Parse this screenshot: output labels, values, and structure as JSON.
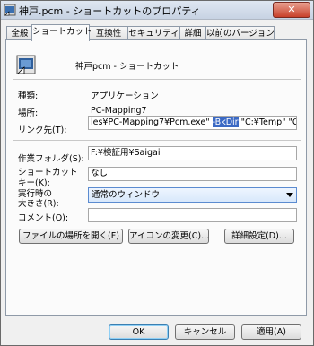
{
  "window": {
    "title": "神戸.pcm - ショートカットのプロパティ",
    "close_glyph": "✕"
  },
  "tabs": [
    {
      "label": "全般"
    },
    {
      "label": "ショートカット"
    },
    {
      "label": "互換性"
    },
    {
      "label": "セキュリティ"
    },
    {
      "label": "詳細"
    },
    {
      "label": "以前のバージョン"
    }
  ],
  "header": {
    "name": "神戸pcm - ショートカット"
  },
  "fields": {
    "type_label": "種類:",
    "type_value": "アプリケーション",
    "location_label": "場所:",
    "location_value": "PC-Mapping7",
    "target_label": "リンク先(T):",
    "target_before": "les¥PC-Mapping7¥Pcm.exe\" ",
    "target_selected": "-BkDir",
    "target_after": " \"C:¥Temp\" \"C:¥",
    "workdir_label": "作業フォルダ(S):",
    "workdir_value": "F:¥検証用¥Saigai",
    "shortcut_label_1": "ショートカット",
    "shortcut_label_2": "キー(K):",
    "shortcut_value": "なし",
    "run_label_1": "実行時の",
    "run_label_2": "大きさ(R):",
    "run_value": "通常のウィンドウ",
    "comment_label": "コメント(O):",
    "comment_value": ""
  },
  "buttons": {
    "open_location": "ファイルの場所を開く(F)",
    "change_icon": "アイコンの変更(C)...",
    "advanced": "詳細設定(D)...",
    "ok": "OK",
    "cancel": "キャンセル",
    "apply": "適用(A)"
  }
}
